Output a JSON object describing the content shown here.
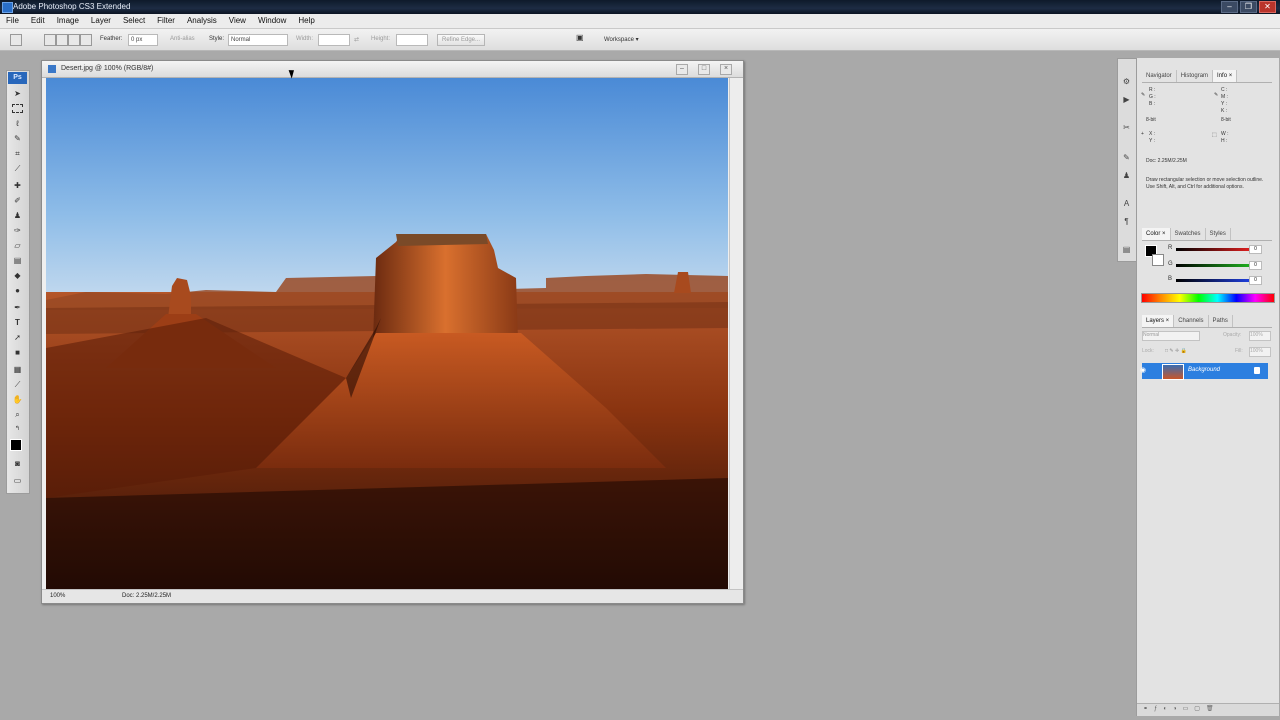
{
  "app": {
    "window_title": "Adobe Photoshop CS3 Extended",
    "menus": [
      "File",
      "Edit",
      "Image",
      "Layer",
      "Select",
      "Filter",
      "Analysis",
      "View",
      "Window",
      "Help"
    ]
  },
  "options_bar": {
    "feather_label": "Feather:",
    "feather_value": "0 px",
    "antialias_label": "Anti-alias",
    "style_label": "Style:",
    "style_value": "Normal",
    "width_label": "Width:",
    "height_label": "Height:",
    "refine_edge_label": "Refine Edge...",
    "workspace_label": "Workspace ▾"
  },
  "document": {
    "title": "Desert.jpg @ 100% (RGB/8#)",
    "zoom": "100%",
    "doc_size": "Doc: 2.25M/2.25M"
  },
  "info_panel": {
    "tabs": [
      "Navigator",
      "Histogram",
      "Info ×"
    ],
    "rgb_labels": [
      "R :",
      "G :",
      "B :"
    ],
    "cmyk_labels": [
      "C :",
      "M :",
      "Y :",
      "K :"
    ],
    "bit_left": "8-bit",
    "bit_right": "8-bit",
    "xy_labels": [
      "X :",
      "Y :"
    ],
    "wh_labels": [
      "W :",
      "H :"
    ],
    "doc_size": "Doc: 2.25M/2.25M",
    "hint": "Draw rectangular selection or move selection outline. Use Shift, Alt, and Ctrl for additional options."
  },
  "color_panel": {
    "tabs": [
      "Color ×",
      "Swatches",
      "Styles"
    ],
    "channels": [
      {
        "label": "R",
        "value": "0",
        "color": "#e02020"
      },
      {
        "label": "G",
        "value": "0",
        "color": "#20b020"
      },
      {
        "label": "B",
        "value": "0",
        "color": "#2040e0"
      }
    ]
  },
  "layers_panel": {
    "tabs": [
      "Layers ×",
      "Channels",
      "Paths"
    ],
    "blend_mode": "Normal",
    "opacity_label": "Opacity:",
    "opacity_value": "100%",
    "lock_label": "Lock:",
    "fill_label": "Fill:",
    "fill_value": "100%",
    "layer_name": "Background"
  }
}
